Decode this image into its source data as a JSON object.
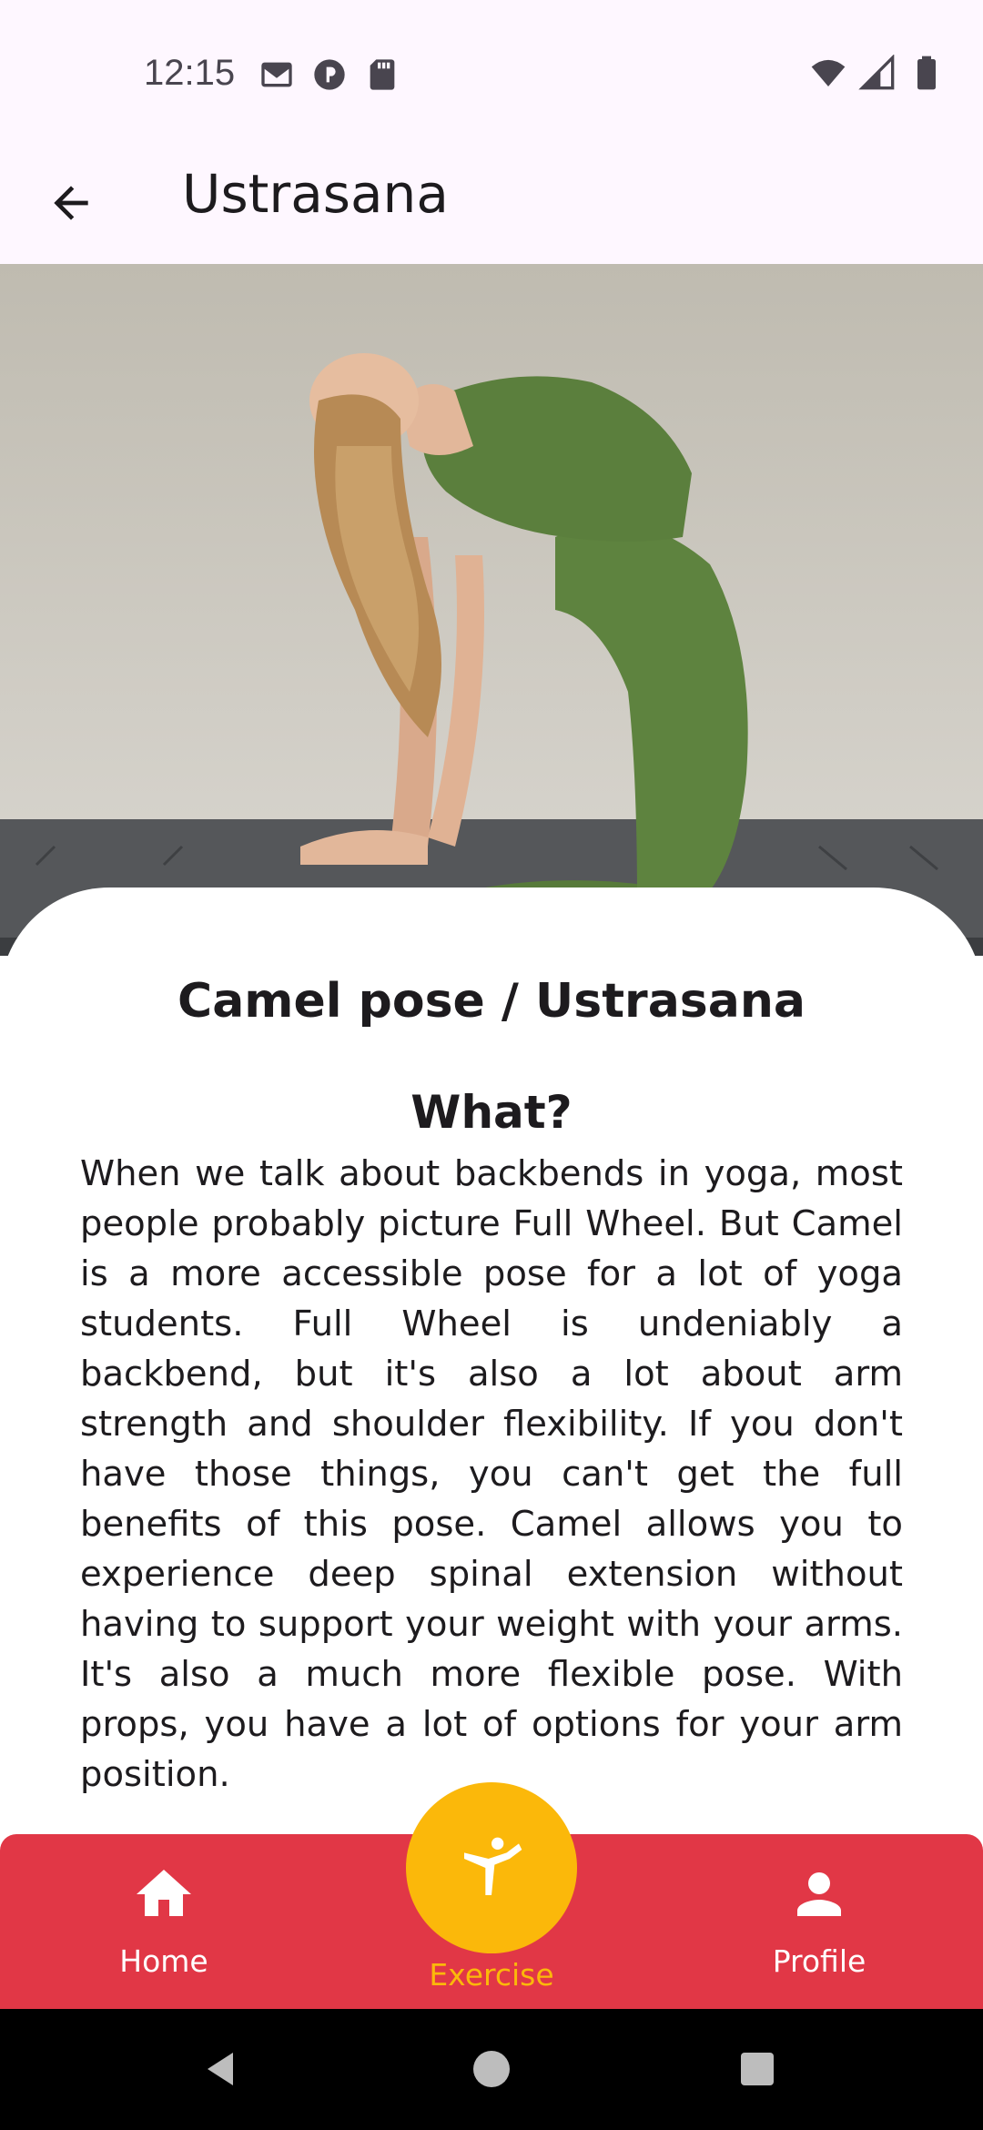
{
  "status": {
    "time": "12:15",
    "left_icons": [
      "gmail-icon",
      "podcast-icon",
      "sd-card-icon"
    ],
    "right_icons": [
      "wifi-icon",
      "signal-icon",
      "battery-icon"
    ]
  },
  "appbar": {
    "title": "Ustrasana",
    "back_icon": "arrow-back-icon"
  },
  "hero": {
    "image": "woman-in-green-performing-camel-pose-photo"
  },
  "content": {
    "pose_title": "Camel pose / Ustrasana",
    "section_title": "What?",
    "description": "When we talk about backbends in yoga, most people probably picture Full Wheel. But Camel is a more accessible pose for a lot of yoga students. Full Wheel is undeniably a backbend, but it's also a lot about arm strength and shoulder flexibility. If you don't have those things, you can't get the full benefits of this pose. Camel allows you to experience deep spinal extension without having to support your weight with your arms. It's also a much more flexible pose. With props, you have a lot of options for your arm position."
  },
  "bottom_nav": {
    "items": [
      {
        "label": "Home",
        "icon": "home-icon",
        "active": false
      },
      {
        "label": "Exercise",
        "icon": "martial-arts-icon",
        "active": true
      },
      {
        "label": "Profile",
        "icon": "person-icon",
        "active": false
      }
    ],
    "colors": {
      "bar": "#e13746",
      "active": "#fbb80a",
      "inactive": "#ffffff"
    }
  },
  "system_nav": {
    "buttons": [
      "back-triangle-icon",
      "home-circle-icon",
      "recents-square-icon"
    ]
  }
}
